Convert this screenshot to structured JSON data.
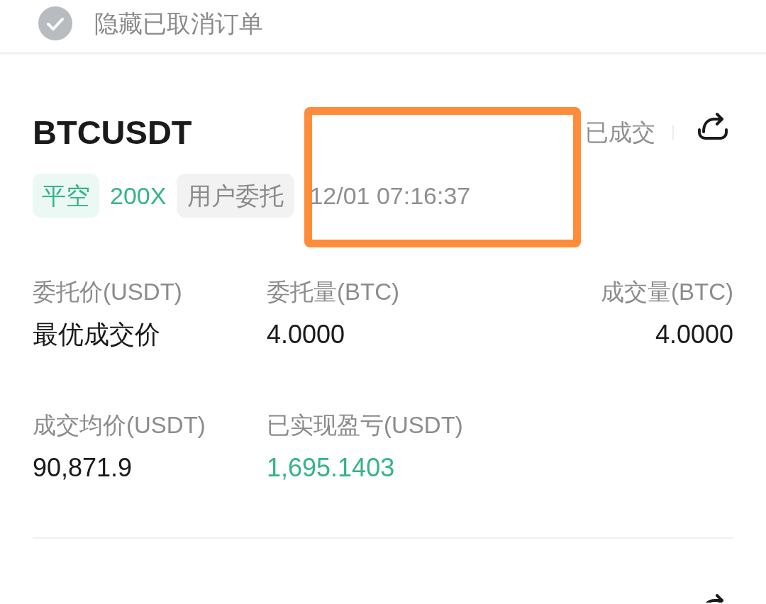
{
  "filter": {
    "label": "隐藏已取消订单",
    "checked": false
  },
  "orders": [
    {
      "symbol": "BTCUSDT",
      "status": "已成交",
      "tags": [
        {
          "kind": "side",
          "label": "平空"
        },
        {
          "kind": "leverage",
          "label": "200X"
        },
        {
          "kind": "source",
          "label": "用户委托"
        }
      ],
      "time": "12/01 07:16:37",
      "fields": [
        {
          "kind": "plain",
          "label": "委托价(USDT)",
          "value": "最优成交价"
        },
        {
          "kind": "plain",
          "label": "委托量(BTC)",
          "value": "4.0000"
        },
        {
          "kind": "plain",
          "label": "成交量(BTC)",
          "value": "4.0000"
        },
        {
          "kind": "plain",
          "label": "成交均价(USDT)",
          "value": "90,871.9"
        },
        {
          "kind": "pnl",
          "label": "已实现盈亏(USDT)",
          "value": "1,695.1403"
        }
      ]
    }
  ]
}
